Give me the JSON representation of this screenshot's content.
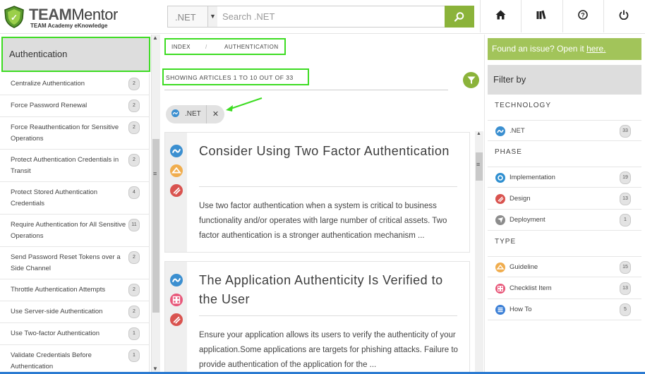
{
  "header": {
    "brand_bold": "TEAM",
    "brand_light": "Mentor",
    "tagline": "TEAM Academy eKnowledge",
    "tech_select": ".NET",
    "search_placeholder": "Search .NET",
    "nav": [
      "home-icon",
      "library-icon",
      "help-icon",
      "power-icon"
    ]
  },
  "sidebar": {
    "title": "Authentication",
    "items": [
      {
        "label": "Centralize Authentication",
        "count": "2"
      },
      {
        "label": "Force Password Renewal",
        "count": "2"
      },
      {
        "label": "Force Reauthentication for Sensitive Operations",
        "count": "2"
      },
      {
        "label": "Protect Authentication Credentials in Transit",
        "count": "2"
      },
      {
        "label": "Protect Stored Authentication Credentials",
        "count": "4"
      },
      {
        "label": "Require Authentication for All Sensitive Operations",
        "count": "11"
      },
      {
        "label": "Send Password Reset Tokens over a Side Channel",
        "count": "2"
      },
      {
        "label": "Throttle Authentication Attempts",
        "count": "2"
      },
      {
        "label": "Use Server-side Authentication",
        "count": "2"
      },
      {
        "label": "Use Two-factor Authentication",
        "count": "1"
      },
      {
        "label": "Validate Credentials Before Authentication",
        "count": "1"
      }
    ]
  },
  "breadcrumb": {
    "index": "INDEX",
    "sep": "/",
    "current": "AUTHENTICATION"
  },
  "results": {
    "summary": "SHOWING ARTICLES 1 TO 10 OUT OF 33"
  },
  "active_filter": {
    "label": ".NET",
    "remove": "✕"
  },
  "articles": [
    {
      "title": "Consider Using Two Factor Authentication",
      "excerpt": "Use two factor authentication when a system is critical to business functionality and/or operates with large number of critical assets. Two factor authentication is a stronger authentication mechanism ...",
      "icons": [
        "dotnet-icon",
        "guideline-icon",
        "design-icon"
      ]
    },
    {
      "title": "The Application Authenticity Is Verified to the User",
      "excerpt": "Ensure your application allows its users to verify the authenticity of your application.Some applications are targets for phishing attacks. Failure to provide authentication of the application for the ...",
      "icons": [
        "dotnet-icon",
        "checklist-icon",
        "design-icon"
      ]
    }
  ],
  "right": {
    "issue_text": "Found an issue? Open it ",
    "issue_link": "here.",
    "filter_title": "Filter by",
    "sections": [
      {
        "title": "TECHNOLOGY",
        "items": [
          {
            "label": ".NET",
            "count": "33",
            "icon": "dotnet-icon",
            "color": "#3b8fd0"
          }
        ]
      },
      {
        "title": "PHASE",
        "items": [
          {
            "label": "Implementation",
            "count": "19",
            "icon": "gear-icon",
            "color": "#2f8fd0"
          },
          {
            "label": "Design",
            "count": "13",
            "icon": "design-icon",
            "color": "#d9534f"
          },
          {
            "label": "Deployment",
            "count": "1",
            "icon": "deploy-icon",
            "color": "#8c8c8c"
          }
        ]
      },
      {
        "title": "TYPE",
        "items": [
          {
            "label": "Guideline",
            "count": "15",
            "icon": "guideline-icon",
            "color": "#f0ad4e"
          },
          {
            "label": "Checklist Item",
            "count": "13",
            "icon": "checklist-icon",
            "color": "#e8587a"
          },
          {
            "label": "How To",
            "count": "5",
            "icon": "howto-icon",
            "color": "#3b7fd6"
          }
        ]
      }
    ]
  },
  "colors": {
    "accent_green": "#8bb33a",
    "highlight": "#3ddc22",
    "issue_bg": "#a2c45a"
  }
}
